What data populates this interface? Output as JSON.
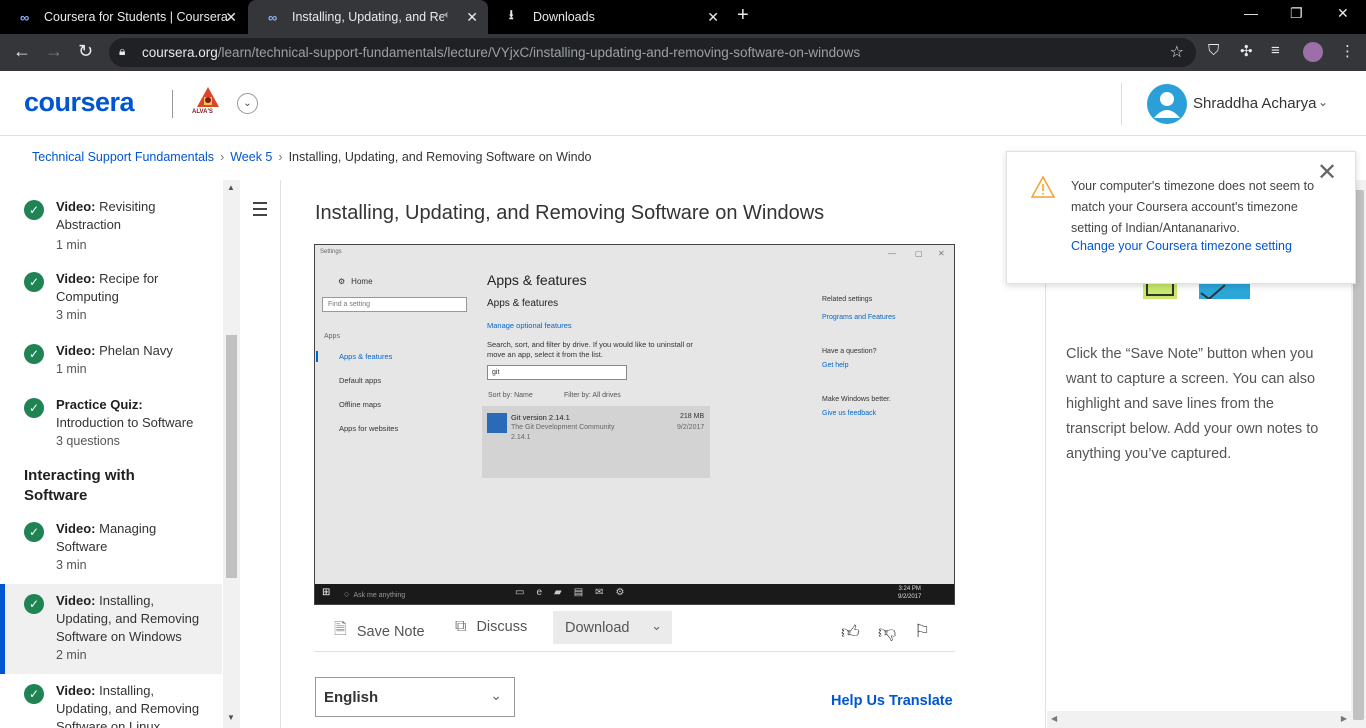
{
  "browser": {
    "tabs": [
      {
        "label": "Coursera for Students | Coursera",
        "active": false
      },
      {
        "label": "Installing, Updating, and Rem",
        "active": true
      },
      {
        "label": "Downloads",
        "active": false
      }
    ],
    "url_host": "coursera.org",
    "url_path": "/learn/technical-support-fundamentals/lecture/VYjxC/installing-updating-and-removing-software-on-windows"
  },
  "header": {
    "logo": "coursera",
    "partner_logo_text": "ALVA'S",
    "user_name": "Shraddha Acharya"
  },
  "breadcrumb": {
    "course": "Technical Support Fundamentals",
    "week": "Week 5",
    "current": "Installing, Updating, and Removing Software on Windo"
  },
  "sidebar": {
    "items": [
      {
        "type": "Video:",
        "title": "Revisiting Abstraction",
        "meta": "1 min"
      },
      {
        "type": "Video:",
        "title": "Recipe for Computing",
        "meta": "3 min"
      },
      {
        "type": "Video:",
        "title": "Phelan Navy",
        "meta": "1 min"
      },
      {
        "type": "Practice Quiz:",
        "title": "Introduction to Software",
        "meta": "3 questions"
      },
      {
        "type": "Video:",
        "title": "Managing Software",
        "meta": "3 min"
      },
      {
        "type": "Video:",
        "title": "Installing, Updating, and Removing Software on Windows",
        "meta": "2 min"
      },
      {
        "type": "Video:",
        "title": "Installing, Updating, and Removing Software on Linux",
        "meta": ""
      }
    ],
    "section_title": "Interacting with Software"
  },
  "lecture": {
    "title": "Installing, Updating, and Removing Software on Windows"
  },
  "video": {
    "window_title": "Settings",
    "home": "Home",
    "search_placeholder": "Find a setting",
    "apps_header": "Apps",
    "nav": [
      "Apps & features",
      "Default apps",
      "Offline maps",
      "Apps for websites"
    ],
    "heading": "Apps & features",
    "subheading": "Apps & features",
    "manage_link": "Manage optional features",
    "body": "Search, sort, and filter by drive. If you would like to uninstall or move an app, select it from the list.",
    "search_value": "git",
    "sort_by": "Sort by: Name",
    "filter_by": "Filter by: All drives",
    "app_name": "Git version 2.14.1",
    "app_publisher": "The Git Development Community",
    "app_version": "2.14.1",
    "app_size": "218 MB",
    "app_date": "9/2/2017",
    "related_title": "Related settings",
    "related_link": "Programs and Features",
    "question_title": "Have a question?",
    "help_link": "Get help",
    "better_title": "Make Windows better.",
    "feedback_link": "Give us feedback",
    "taskbar_search": "Ask me anything",
    "clock_time": "3:24 PM",
    "clock_date": "9/2/2017"
  },
  "actions": {
    "save_note": "Save Note",
    "discuss": "Discuss",
    "download": "Download"
  },
  "language": {
    "selected": "English",
    "help_translate": "Help Us Translate"
  },
  "notes": {
    "text": "Click the “Save Note” button when you want to capture a screen. You can also highlight and save lines from the transcript below. Add your own notes to anything you’ve captured."
  },
  "timezone_alert": {
    "message": "Your computer's timezone does not seem to match your Coursera account's timezone setting of Indian/Antananarivo.",
    "link": "Change your Coursera timezone setting"
  },
  "colors": {
    "brand": "#0056d2",
    "check_green": "#1f8354",
    "warning": "#f4a12b"
  }
}
